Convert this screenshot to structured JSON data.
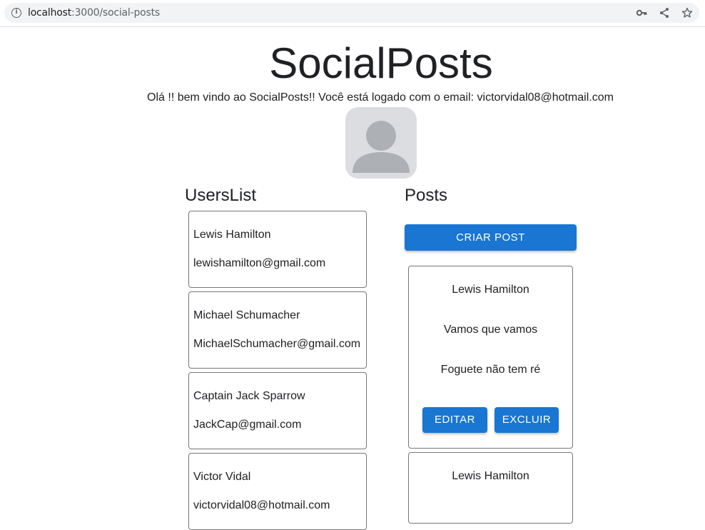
{
  "browser": {
    "url_host": "localhost",
    "url_rest": ":3000/social-posts"
  },
  "header": {
    "title": "SocialPosts",
    "welcome": "Olá !! bem vindo ao SocialPosts!! Você está logado com o email: victorvidal08@hotmail.com"
  },
  "users_section": {
    "title": "UsersList",
    "users": [
      {
        "name": "Lewis Hamilton",
        "email": "lewishamilton@gmail.com"
      },
      {
        "name": "Michael Schumacher",
        "email": "MichaelSchumacher@gmail.com"
      },
      {
        "name": "Captain Jack Sparrow",
        "email": "JackCap@gmail.com"
      },
      {
        "name": "Victor Vidal",
        "email": "victorvidal08@hotmail.com"
      }
    ]
  },
  "posts_section": {
    "title": "Posts",
    "create_label": "CRIAR POST",
    "edit_label": "EDITAR",
    "delete_label": "EXCLUIR",
    "posts": [
      {
        "author": "Lewis Hamilton",
        "title": "Vamos que vamos",
        "body": "Foguete não tem ré"
      },
      {
        "author": "Lewis Hamilton"
      }
    ]
  },
  "colors": {
    "primary": "#1976d2",
    "avatar_bg": "#dcdde0",
    "avatar_fg": "#adb1b5"
  },
  "icons": [
    "info-icon",
    "key-icon",
    "share-icon",
    "star-icon",
    "user-avatar-icon"
  ]
}
